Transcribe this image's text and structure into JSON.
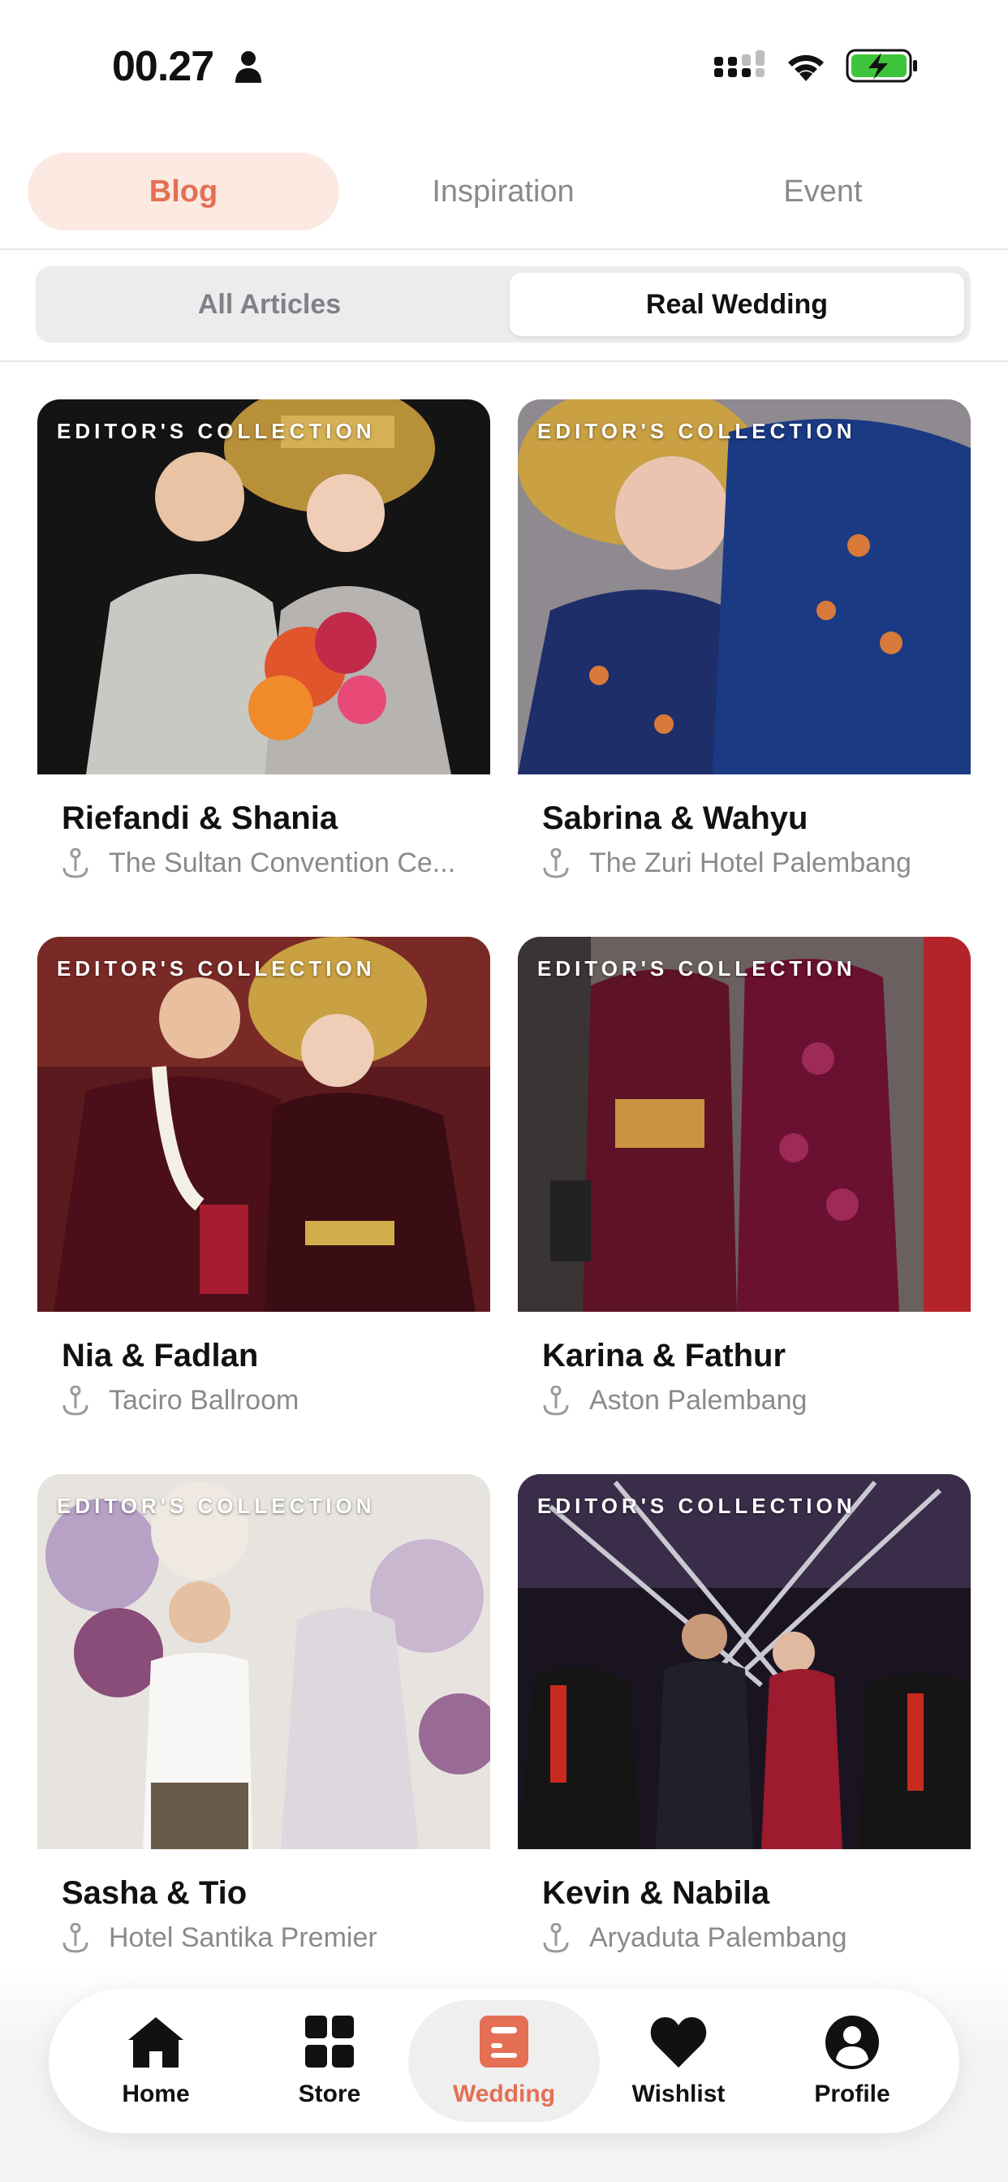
{
  "status_bar": {
    "time": "00.27",
    "icons": [
      "person-icon",
      "signal-icon",
      "wifi-icon",
      "battery-charging-icon"
    ],
    "battery_color": "#3ec43a"
  },
  "top_tabs": [
    {
      "label": "Blog",
      "active": true
    },
    {
      "label": "Inspiration",
      "active": false
    },
    {
      "label": "Event",
      "active": false
    }
  ],
  "segmented": {
    "options": [
      {
        "label": "All Articles",
        "active": false
      },
      {
        "label": "Real Wedding",
        "active": true
      }
    ]
  },
  "cards": [
    {
      "badge": "EDITOR'S COLLECTION",
      "title": "Riefandi & Shania",
      "location": "The Sultan Convention Ce..."
    },
    {
      "badge": "EDITOR'S COLLECTION",
      "title": "Sabrina & Wahyu",
      "location": "The Zuri Hotel Palembang"
    },
    {
      "badge": "EDITOR'S COLLECTION",
      "title": "Nia & Fadlan",
      "location": "Taciro Ballroom"
    },
    {
      "badge": "EDITOR'S COLLECTION",
      "title": "Karina & Fathur",
      "location": "Aston Palembang"
    },
    {
      "badge": "EDITOR'S COLLECTION",
      "title": "Sasha & Tio",
      "location": "Hotel Santika Premier"
    },
    {
      "badge": "EDITOR'S COLLECTION",
      "title": "Kevin & Nabila",
      "location": "Aryaduta Palembang"
    }
  ],
  "bottom_nav": [
    {
      "label": "Home",
      "icon": "home-icon",
      "active": false
    },
    {
      "label": "Store",
      "icon": "grid-icon",
      "active": false
    },
    {
      "label": "Wedding",
      "icon": "document-icon",
      "active": true
    },
    {
      "label": "Wishlist",
      "icon": "heart-icon",
      "active": false
    },
    {
      "label": "Profile",
      "icon": "user-circle-icon",
      "active": false
    }
  ],
  "colors": {
    "accent": "#e46f54",
    "accent_bg": "#fce9e2"
  }
}
